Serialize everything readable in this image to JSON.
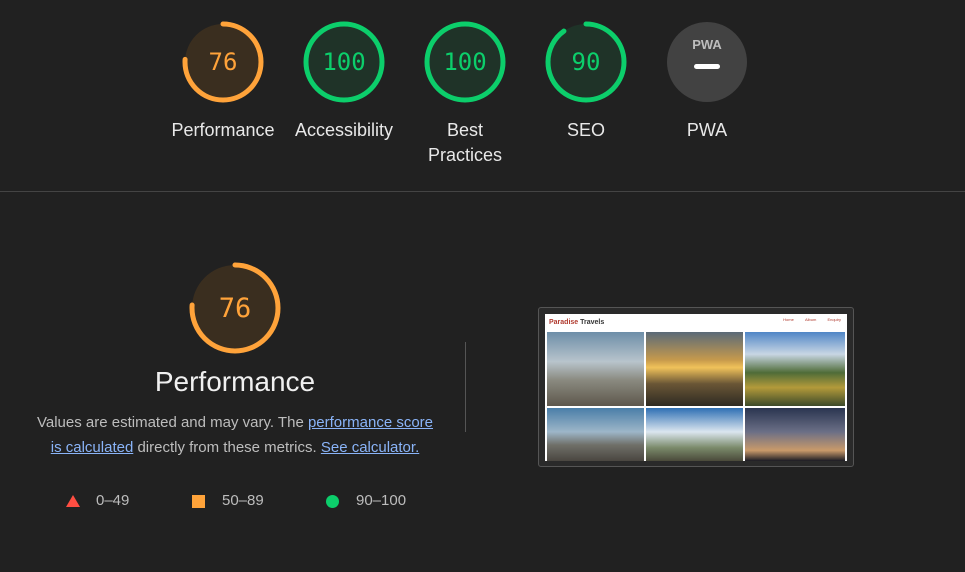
{
  "gauges": [
    {
      "id": "performance",
      "score": "76",
      "value": 76,
      "label": "Performance",
      "color": "#ffa33a"
    },
    {
      "id": "accessibility",
      "score": "100",
      "value": 100,
      "label": "Accessibility",
      "color": "#0cce6b"
    },
    {
      "id": "best-practices",
      "score": "100",
      "value": 100,
      "label_line1": "Best",
      "label_line2": "Practices",
      "color": "#0cce6b"
    },
    {
      "id": "seo",
      "score": "90",
      "value": 90,
      "label": "SEO",
      "color": "#0cce6b"
    },
    {
      "id": "pwa",
      "badge": "PWA",
      "label": "PWA"
    }
  ],
  "performance": {
    "score": "76",
    "value": 76,
    "title": "Performance",
    "desc_prefix": "Values are estimated and may vary. The ",
    "link1": "performance score is calculated",
    "desc_mid": " directly from these metrics. ",
    "link2": "See calculator."
  },
  "legend": [
    {
      "shape": "triangle",
      "range": "0–49",
      "color": "#ff4e42"
    },
    {
      "shape": "square",
      "range": "50–89",
      "color": "#ffa33a"
    },
    {
      "shape": "circle",
      "range": "90–100",
      "color": "#0cce6b"
    }
  ],
  "screenshot": {
    "brand_part1": "Paradise",
    "brand_part2": " Travels",
    "nav": [
      "Home",
      "Album",
      "Enquiry"
    ]
  }
}
